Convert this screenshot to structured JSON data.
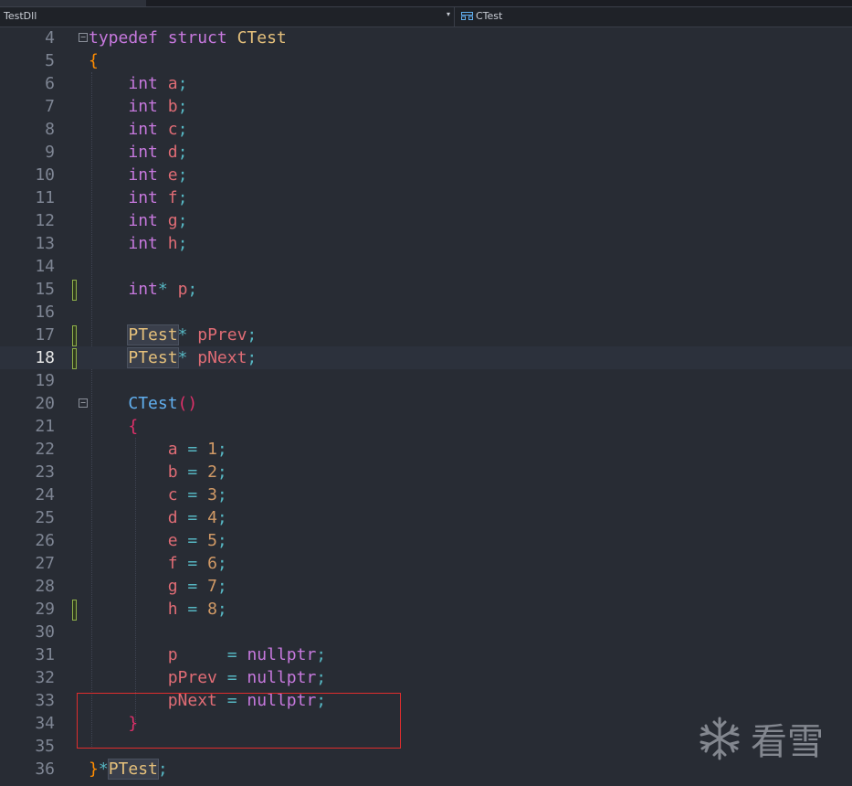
{
  "navbar": {
    "project": "TestDll",
    "scope": "CTest",
    "dropdown_arrow": "▾",
    "scope_icon": "struct-icon"
  },
  "watermark": {
    "text": "看雪",
    "icon": "snowflake-icon"
  },
  "current_line": 18,
  "lines": [
    {
      "n": "4"
    },
    {
      "n": "5"
    },
    {
      "n": "6"
    },
    {
      "n": "7"
    },
    {
      "n": "8"
    },
    {
      "n": "9"
    },
    {
      "n": "10"
    },
    {
      "n": "11"
    },
    {
      "n": "12"
    },
    {
      "n": "13"
    },
    {
      "n": "14"
    },
    {
      "n": "15"
    },
    {
      "n": "16"
    },
    {
      "n": "17"
    },
    {
      "n": "18"
    },
    {
      "n": "19"
    },
    {
      "n": "20"
    },
    {
      "n": "21"
    },
    {
      "n": "22"
    },
    {
      "n": "23"
    },
    {
      "n": "24"
    },
    {
      "n": "25"
    },
    {
      "n": "26"
    },
    {
      "n": "27"
    },
    {
      "n": "28"
    },
    {
      "n": "29"
    },
    {
      "n": "30"
    },
    {
      "n": "31"
    },
    {
      "n": "32"
    },
    {
      "n": "33"
    },
    {
      "n": "34"
    },
    {
      "n": "35"
    },
    {
      "n": "36"
    }
  ],
  "code": {
    "l4": {
      "k1": "typedef",
      "k2": "struct",
      "t": "CTest"
    },
    "l5": {
      "b": "{"
    },
    "l6": {
      "k": "int",
      "v": "a",
      "s": ";"
    },
    "l7": {
      "k": "int",
      "v": "b",
      "s": ";"
    },
    "l8": {
      "k": "int",
      "v": "c",
      "s": ";"
    },
    "l9": {
      "k": "int",
      "v": "d",
      "s": ";"
    },
    "l10": {
      "k": "int",
      "v": "e",
      "s": ";"
    },
    "l11": {
      "k": "int",
      "v": "f",
      "s": ";"
    },
    "l12": {
      "k": "int",
      "v": "g",
      "s": ";"
    },
    "l13": {
      "k": "int",
      "v": "h",
      "s": ";"
    },
    "l15": {
      "k": "int",
      "star": "*",
      "v": "p",
      "s": ";"
    },
    "l17": {
      "t": "PTest",
      "star": "*",
      "v": "pPrev",
      "s": ";"
    },
    "l18": {
      "t": "PTest",
      "star": "*",
      "v": "pNext",
      "s": ";"
    },
    "l20": {
      "f": "CTest",
      "paren": "()"
    },
    "l21": {
      "b": "{"
    },
    "l22": {
      "v": "a",
      "eq": "=",
      "num": "1",
      "s": ";"
    },
    "l23": {
      "v": "b",
      "eq": "=",
      "num": "2",
      "s": ";"
    },
    "l24": {
      "v": "c",
      "eq": "=",
      "num": "3",
      "s": ";"
    },
    "l25": {
      "v": "d",
      "eq": "=",
      "num": "4",
      "s": ";"
    },
    "l26": {
      "v": "e",
      "eq": "=",
      "num": "5",
      "s": ";"
    },
    "l27": {
      "v": "f",
      "eq": "=",
      "num": "6",
      "s": ";"
    },
    "l28": {
      "v": "g",
      "eq": "=",
      "num": "7",
      "s": ";"
    },
    "l29": {
      "v": "h",
      "eq": "=",
      "num": "8",
      "s": ";"
    },
    "l31": {
      "v": "p",
      "pad": "    ",
      "eq": "=",
      "k": "nullptr",
      "s": ";"
    },
    "l32": {
      "v": "pPrev",
      "eq": "=",
      "k": "nullptr",
      "s": ";"
    },
    "l33": {
      "v": "pNext",
      "eq": "=",
      "k": "nullptr",
      "s": ";"
    },
    "l34": {
      "b": "}"
    },
    "l36": {
      "b": "}",
      "star": "*",
      "t": "PTest",
      "s": ";"
    }
  },
  "colors": {
    "keyword": "#c678dd",
    "type": "#e5c07b",
    "function": "#61afef",
    "variable": "#e06c75",
    "number": "#d19a66",
    "operator": "#56b6c2",
    "brace": "#ff8c00",
    "annotation_box": "#e02d2d"
  }
}
